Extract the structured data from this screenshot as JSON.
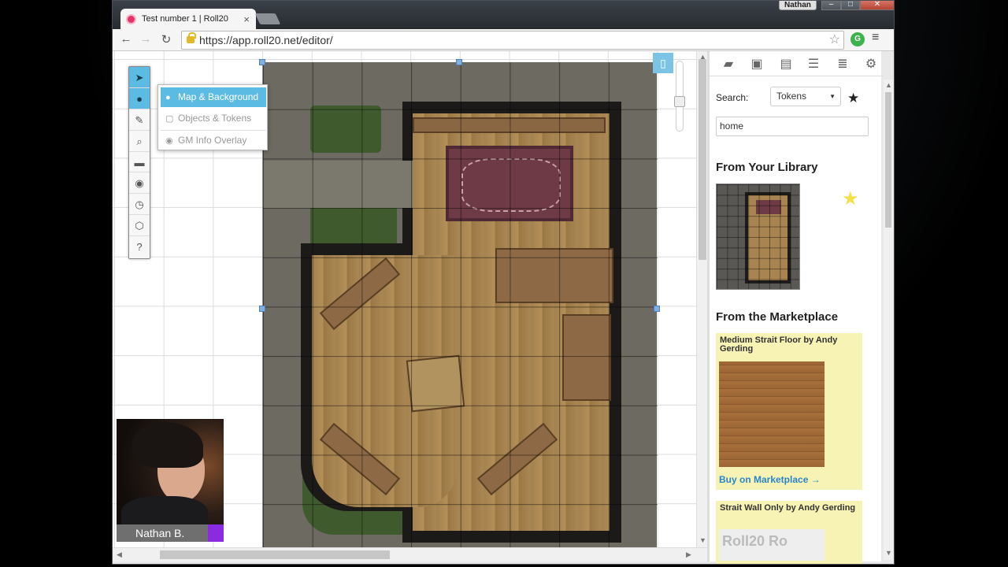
{
  "browser": {
    "tab_title": "Test number 1 | Roll20",
    "tab_close": "×",
    "user": "Nathan",
    "url": "https://app.roll20.net/editor/",
    "win_minimize": "–",
    "win_maximize": "□",
    "win_close": "✕"
  },
  "toolbar": {
    "tools": [
      "select-pointer-icon",
      "layer-marker-icon",
      "draw-brush-icon",
      "zoom-icon",
      "measure-ruler-icon",
      "fog-eye-icon",
      "turn-clock-icon",
      "dice-icon",
      "help-icon"
    ],
    "layers": [
      {
        "label": "Map & Background",
        "icon": "map-marker-icon",
        "active": true
      },
      {
        "label": "Objects & Tokens",
        "icon": "cube-icon",
        "active": false
      },
      {
        "label": "GM Info Overlay",
        "icon": "eye-icon",
        "active": false
      }
    ]
  },
  "video": {
    "name": "Nathan B.",
    "player_color": "#8a2be2"
  },
  "panel": {
    "tabs": [
      "chat-icon",
      "art-library-icon",
      "journal-icon",
      "compendium-icon",
      "jukebox-icon",
      "settings-icon"
    ],
    "search_label": "Search:",
    "search_type": "Tokens",
    "search_value": "home",
    "library_heading": "From Your Library",
    "marketplace_heading": "From the Marketplace",
    "items": [
      {
        "title": "Medium Strait Floor by Andy Gerding",
        "buy": "Buy on Marketplace →"
      },
      {
        "title": "Strait Wall Only by Andy Gerding",
        "preview": "Roll20 Ro"
      }
    ]
  },
  "colors": {
    "accent": "#5bbbe3",
    "link": "#2a85c8",
    "card": "#f6f3b5"
  }
}
